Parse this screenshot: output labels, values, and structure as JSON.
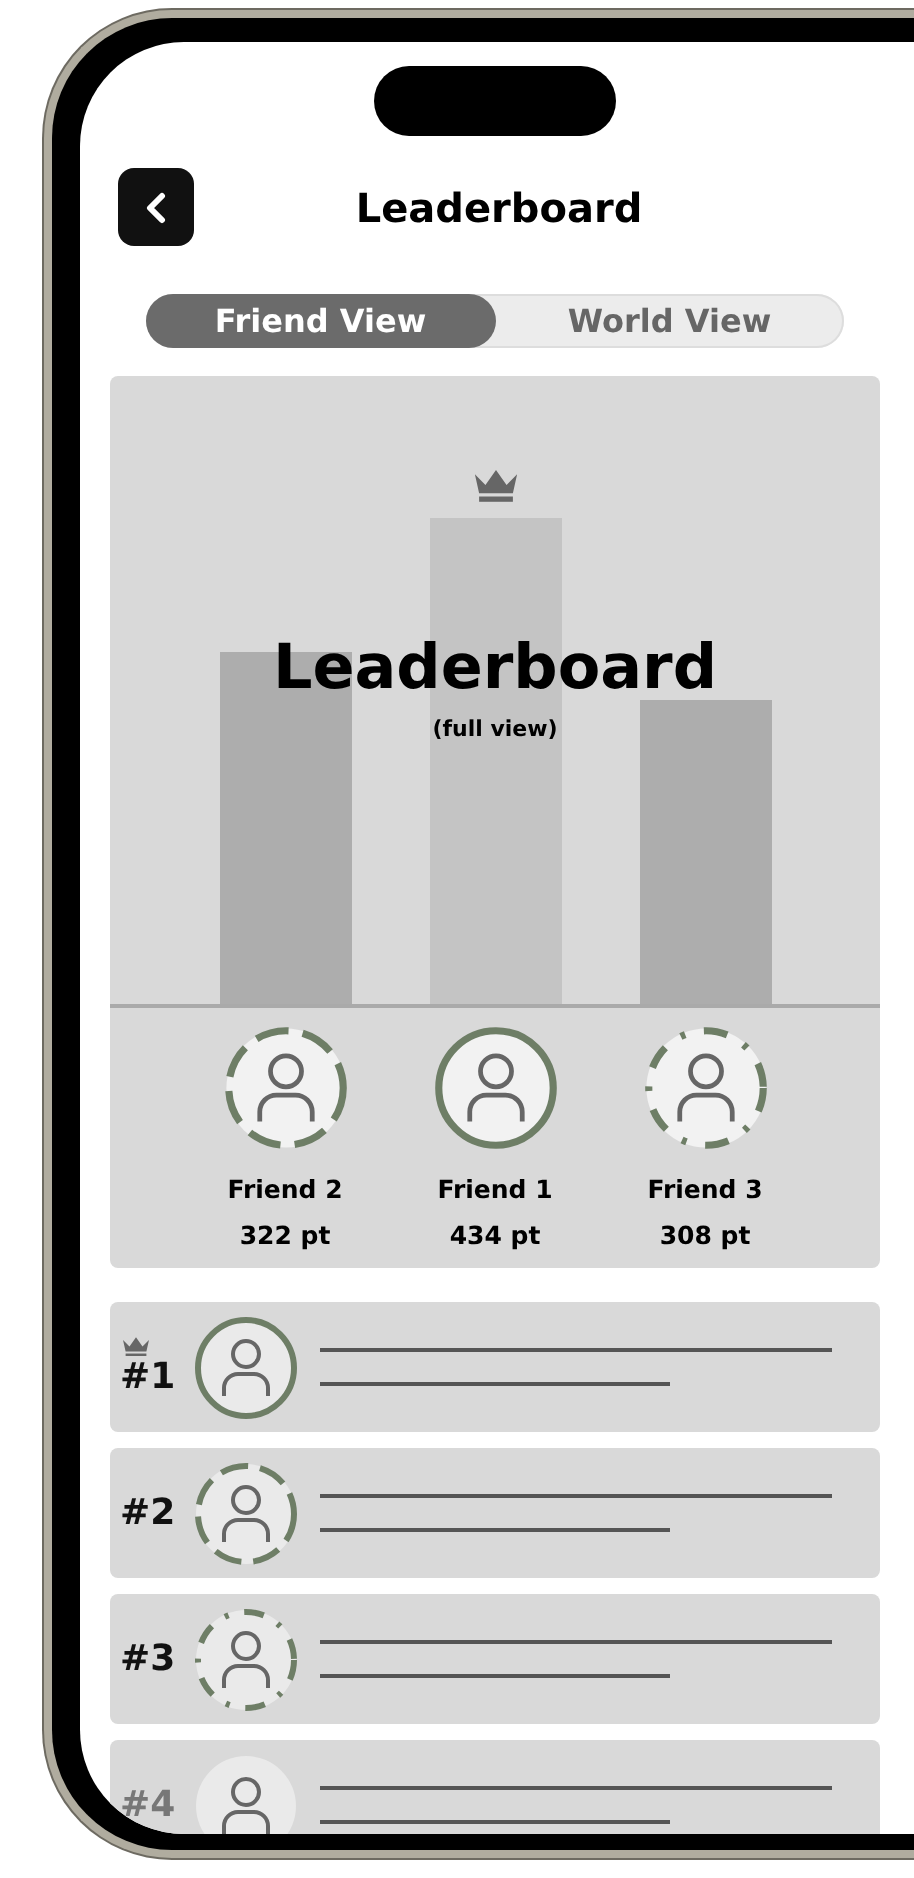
{
  "header": {
    "title": "Leaderboard"
  },
  "tabs": [
    {
      "label": "Friend View",
      "selected": true
    },
    {
      "label": "World View",
      "selected": false
    }
  ],
  "podium": {
    "title": "Leaderboard",
    "subtitle": "(full view)",
    "places": [
      {
        "name": "Friend 2",
        "points": "322 pt",
        "color": "#adadad",
        "crowned": false,
        "kind": "dashed"
      },
      {
        "name": "Friend 1",
        "points": "434 pt",
        "color": "#c4c4c4",
        "crowned": true,
        "kind": "solid"
      },
      {
        "name": "Friend 3",
        "points": "308 pt",
        "color": "#adadad",
        "crowned": false,
        "kind": "dotted"
      }
    ]
  },
  "rows": [
    {
      "rank": "#1",
      "crowned": true,
      "kind": "solid",
      "dimmed": false
    },
    {
      "rank": "#2",
      "crowned": false,
      "kind": "dashed",
      "dimmed": false
    },
    {
      "rank": "#3",
      "crowned": false,
      "kind": "dotted",
      "dimmed": false
    },
    {
      "rank": "#4",
      "crowned": false,
      "kind": "none",
      "dimmed": true
    }
  ]
}
